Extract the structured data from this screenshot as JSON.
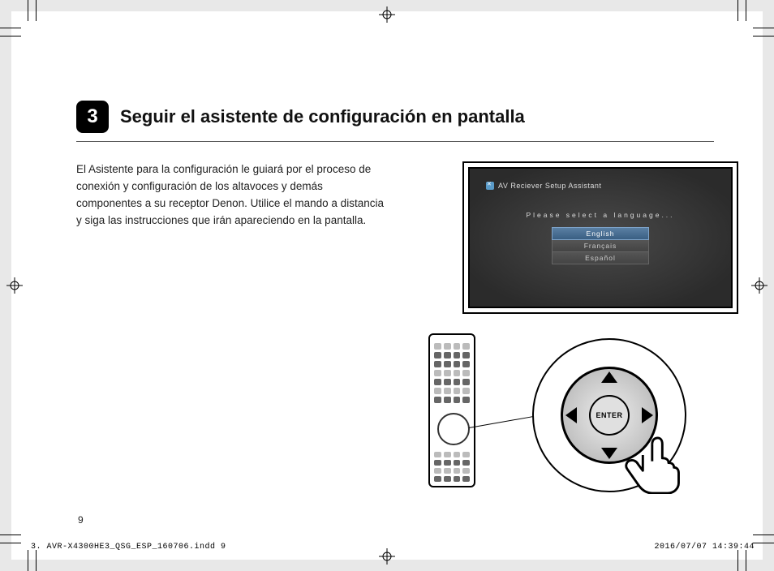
{
  "step_number": "3",
  "heading": "Seguir el asistente de configuración en pantalla",
  "body": "El Asistente para la configuración le guiará por el proceso de conexión y configuración de los altavoces y demás componentes a su receptor Denon. Utilice el mando a distancia y siga las instrucciones que irán apareciendo en la pantalla.",
  "tv": {
    "title": "AV Reciever Setup Assistant",
    "prompt": "Please select a language...",
    "languages": [
      "English",
      "Français",
      "Español"
    ]
  },
  "dpad_center_label": "ENTER",
  "page_number": "9",
  "footer_left": "3. AVR-X4300HE3_QSG_ESP_160706.indd   9",
  "footer_right": "2016/07/07   14:39:44"
}
